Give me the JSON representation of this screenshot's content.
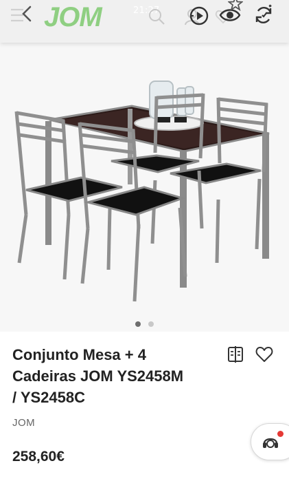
{
  "status_bar": {
    "time": "21:27"
  },
  "header": {
    "logo_text": "JOM",
    "logo_color": "#8fcf82",
    "icons": [
      "back-icon",
      "search-icon",
      "profile-icon",
      "play-icon",
      "heart-icon",
      "eye-icon",
      "star-icon",
      "refresh-icon"
    ]
  },
  "gallery": {
    "image_count": 2,
    "active_index": 0
  },
  "product": {
    "title_lines": [
      "Conjunto Mesa + 4",
      "Cadeiras JOM YS2458M",
      "/ YS2458C"
    ],
    "brand": "JOM",
    "price": "258,60€"
  },
  "actions": {
    "icons": [
      "compare-icon",
      "heart-outline-icon",
      "chat-support-icon"
    ]
  },
  "colors": {
    "accent_notification": "#e53935",
    "text_primary": "#222222"
  }
}
